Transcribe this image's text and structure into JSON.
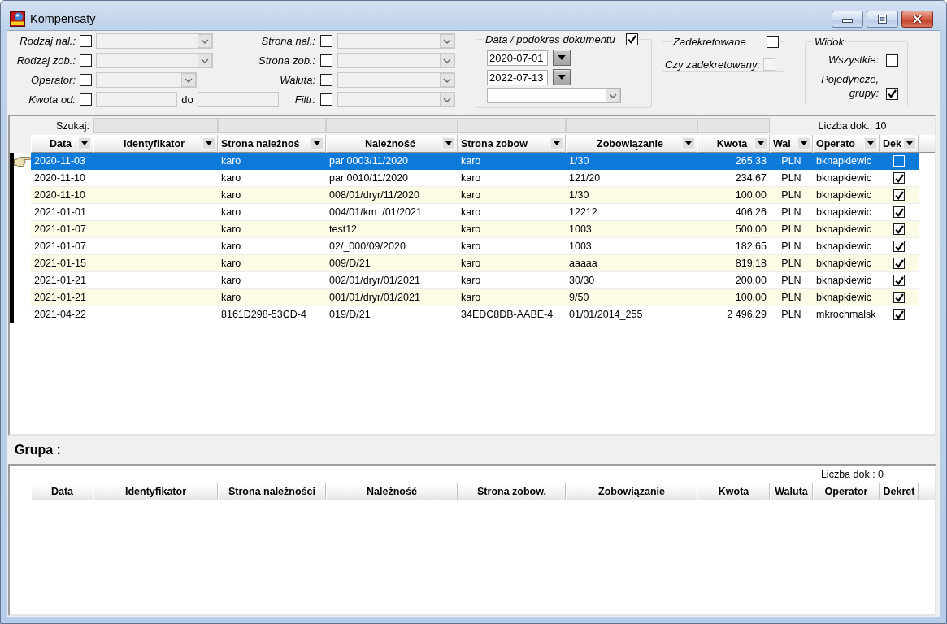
{
  "window": {
    "title": "Kompensaty"
  },
  "filters": {
    "left": [
      {
        "kind": "combo",
        "label": "Rodzaj nal.:",
        "checked": false
      },
      {
        "kind": "combo",
        "label": "Rodzaj zob.:",
        "checked": false
      },
      {
        "kind": "short_combo",
        "label": "Operator:",
        "checked": false
      },
      {
        "kind": "range",
        "label": "Kwota od:",
        "checked": false,
        "to_label": "do"
      }
    ],
    "right": [
      {
        "kind": "combo",
        "label": "Strona nal.:",
        "checked": false
      },
      {
        "kind": "combo",
        "label": "Strona zob.:",
        "checked": false
      },
      {
        "kind": "combo",
        "label": "Waluta:",
        "checked": false
      },
      {
        "kind": "combo",
        "label": "Filtr:",
        "checked": false
      }
    ]
  },
  "date_group": {
    "title": "Data / podokres dokumentu",
    "checked": true,
    "date_from": "2020-07-01",
    "date_to": "2022-07-13"
  },
  "posted_group": {
    "title": "Zadekretowane",
    "checked": false,
    "option": {
      "label": "Czy zadekretowany:",
      "checked": false,
      "disabled": true
    }
  },
  "view_group": {
    "title": "Widok",
    "options": [
      {
        "label": "Wszystkie:",
        "checked": false
      },
      {
        "label": "Pojedyncze, grupy:",
        "checked": true
      }
    ]
  },
  "main_grid": {
    "search_label": "Szukaj:",
    "count": "Liczba dok.: 10",
    "column_menus": true,
    "columns": [
      {
        "label": "Data",
        "kind": "text",
        "searchable": false
      },
      {
        "label": "Identyfikator",
        "kind": "text",
        "searchable": true
      },
      {
        "label": "Strona należnoś",
        "kind": "text",
        "searchable": true
      },
      {
        "label": "Należność",
        "kind": "text",
        "searchable": true
      },
      {
        "label": "Strona zobow",
        "kind": "text",
        "searchable": true
      },
      {
        "label": "Zobowiązanie",
        "kind": "text",
        "searchable": true
      },
      {
        "label": "Kwota",
        "kind": "amount",
        "searchable": true
      },
      {
        "label": "Wal",
        "kind": "code",
        "searchable": false
      },
      {
        "label": "Operato",
        "kind": "text",
        "searchable": false
      },
      {
        "label": "Dek",
        "kind": "check",
        "searchable": false
      }
    ],
    "rows": [
      {
        "selected": true,
        "data": "2020-11-03",
        "strona_naleznosci": "karo",
        "naleznosc": "par 0003/11/2020",
        "strona_zobowiazan": "karo",
        "zobowiazanie": "1/30",
        "kwota": "265,33",
        "waluta": "PLN",
        "operator": "bknapkiewic",
        "dekret": false
      },
      {
        "selected": false,
        "data": "2020-11-10",
        "strona_naleznosci": "karo",
        "naleznosc": "par 0010/11/2020",
        "strona_zobowiazan": "karo",
        "zobowiazanie": "121/20",
        "kwota": "234,67",
        "waluta": "PLN",
        "operator": "bknapkiewic",
        "dekret": true
      },
      {
        "selected": false,
        "data": "2020-11-10",
        "strona_naleznosci": "karo",
        "naleznosc": "008/01/dryr/11/2020",
        "strona_zobowiazan": "karo",
        "zobowiazanie": "1/30",
        "kwota": "100,00",
        "waluta": "PLN",
        "operator": "bknapkiewic",
        "dekret": true
      },
      {
        "selected": false,
        "data": "2021-01-01",
        "strona_naleznosci": "karo",
        "naleznosc": "004/01/km  /01/2021",
        "strona_zobowiazan": "karo",
        "zobowiazanie": "12212",
        "kwota": "406,26",
        "waluta": "PLN",
        "operator": "bknapkiewic",
        "dekret": true
      },
      {
        "selected": false,
        "data": "2021-01-07",
        "strona_naleznosci": "karo",
        "naleznosc": "test12",
        "strona_zobowiazan": "karo",
        "zobowiazanie": "1003",
        "kwota": "500,00",
        "waluta": "PLN",
        "operator": "bknapkiewic",
        "dekret": true
      },
      {
        "selected": false,
        "data": "2021-01-07",
        "strona_naleznosci": "karo",
        "naleznosc": "02/_000/09/2020",
        "strona_zobowiazan": "karo",
        "zobowiazanie": "1003",
        "kwota": "182,65",
        "waluta": "PLN",
        "operator": "bknapkiewic",
        "dekret": true
      },
      {
        "selected": false,
        "data": "2021-01-15",
        "strona_naleznosci": "karo",
        "naleznosc": "009/D/21",
        "strona_zobowiazan": "karo",
        "zobowiazanie": "aaaaa",
        "kwota": "819,18",
        "waluta": "PLN",
        "operator": "bknapkiewic",
        "dekret": true
      },
      {
        "selected": false,
        "data": "2021-01-21",
        "strona_naleznosci": "karo",
        "naleznosc": "002/01/dryr/01/2021",
        "strona_zobowiazan": "karo",
        "zobowiazanie": "30/30",
        "kwota": "200,00",
        "waluta": "PLN",
        "operator": "bknapkiewic",
        "dekret": true
      },
      {
        "selected": false,
        "data": "2021-01-21",
        "strona_naleznosci": "karo",
        "naleznosc": "001/01/dryr/01/2021",
        "strona_zobowiazan": "karo",
        "zobowiazanie": "9/50",
        "kwota": "100,00",
        "waluta": "PLN",
        "operator": "bknapkiewic",
        "dekret": true
      },
      {
        "selected": false,
        "data": "2021-04-22",
        "strona_naleznosci": "8161D298-53CD-4",
        "naleznosc": "019/D/21",
        "strona_zobowiazan": "34EDC8DB-AABE-4",
        "zobowiazanie": "01/01/2014_255",
        "kwota": "2 496,29",
        "waluta": "PLN",
        "operator": "mkrochmalsk",
        "dekret": true
      }
    ]
  },
  "group": {
    "title": "Grupa :",
    "grid": {
      "count": "Liczba dok.: 0",
      "column_menus": false,
      "columns": [
        {
          "label": "Data"
        },
        {
          "label": "Identyfikator"
        },
        {
          "label": "Strona należności"
        },
        {
          "label": "Należność"
        },
        {
          "label": "Strona zobow."
        },
        {
          "label": "Zobowiązanie"
        },
        {
          "label": "Kwota"
        },
        {
          "label": "Waluta"
        },
        {
          "label": "Operator"
        },
        {
          "label": "Dekret"
        }
      ]
    }
  }
}
